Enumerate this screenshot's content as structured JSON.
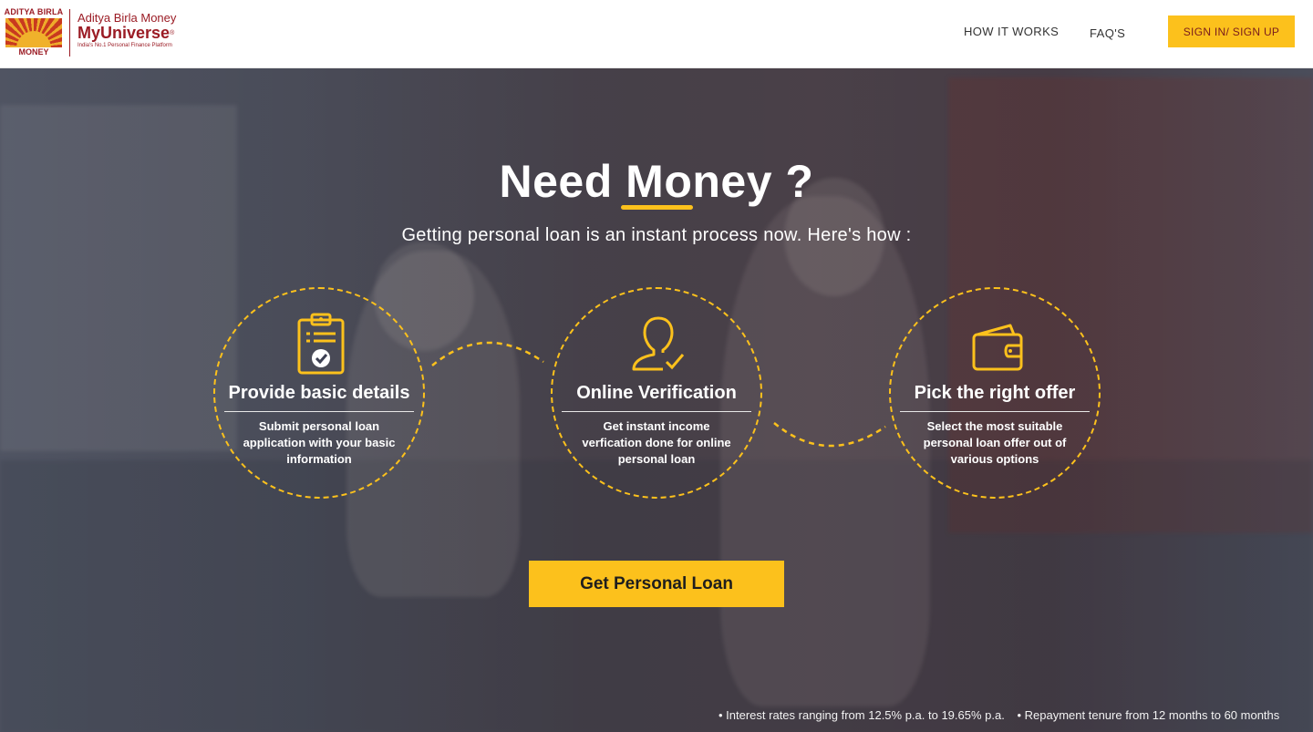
{
  "brand": {
    "badge_top": "ADITYA BIRLA",
    "badge_bottom": "MONEY",
    "line1": "Aditya Birla Money",
    "line2": "MyUniverse",
    "trademark": "®",
    "tagline": "India's No.1 Personal Finance Platform",
    "colors": {
      "maroon": "#9b1c25",
      "accent_yellow": "#fcc11c"
    }
  },
  "nav": {
    "how_it_works": "HOW IT WORKS",
    "faqs": "FAQ'S",
    "signin": "SIGN IN/ SIGN UP"
  },
  "hero": {
    "title": "Need Money ?",
    "subtitle": "Getting personal loan is an instant process now. Here's how :",
    "steps": [
      {
        "icon": "clipboard-check-icon",
        "title": "Provide basic details",
        "desc": "Submit personal loan application with your basic information"
      },
      {
        "icon": "user-check-icon",
        "title": "Online Verification",
        "desc": "Get instant income verfication done for online personal loan"
      },
      {
        "icon": "wallet-icon",
        "title": "Pick the right offer",
        "desc": "Select the most suitable personal loan offer out of various options"
      }
    ],
    "cta": "Get Personal Loan",
    "notes": [
      "• Interest rates ranging from 12.5% p.a. to 19.65% p.a.",
      "• Repayment tenure from 12 months to 60 months"
    ]
  }
}
